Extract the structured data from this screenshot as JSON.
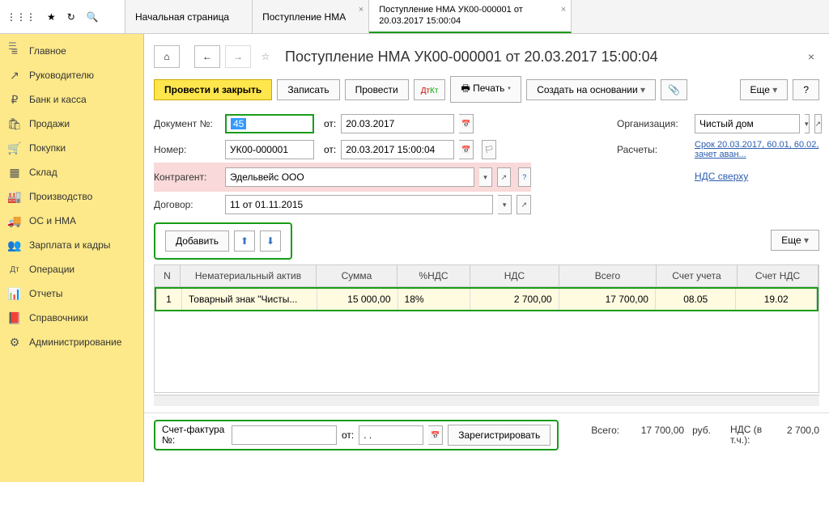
{
  "tabs": [
    {
      "label": "Начальная страница"
    },
    {
      "label": "Поступление НМА"
    },
    {
      "label": "Поступление НМА УК00-000001 от 20.03.2017 15:00:04",
      "active": true
    }
  ],
  "sidebar": {
    "items": [
      {
        "label": "Главное",
        "icon": "≡"
      },
      {
        "label": "Руководителю",
        "icon": "↗"
      },
      {
        "label": "Банк и касса",
        "icon": "₽"
      },
      {
        "label": "Продажи",
        "icon": "🛍"
      },
      {
        "label": "Покупки",
        "icon": "🛒"
      },
      {
        "label": "Склад",
        "icon": "▦"
      },
      {
        "label": "Производство",
        "icon": "🏭"
      },
      {
        "label": "ОС и НМА",
        "icon": "🚚"
      },
      {
        "label": "Зарплата и кадры",
        "icon": "👥"
      },
      {
        "label": "Операции",
        "icon": "Дт"
      },
      {
        "label": "Отчеты",
        "icon": "📊"
      },
      {
        "label": "Справочники",
        "icon": "📕"
      },
      {
        "label": "Администрирование",
        "icon": "⚙"
      }
    ]
  },
  "doc": {
    "title": "Поступление НМА УК00-000001 от 20.03.2017 15:00:04",
    "actions": {
      "post_close": "Провести и закрыть",
      "write": "Записать",
      "post": "Провести",
      "print": "Печать",
      "create_based": "Создать на основании",
      "more": "Еще",
      "help": "?"
    },
    "labels": {
      "doc_no": "Документ №:",
      "from": "от:",
      "number": "Номер:",
      "counterparty": "Контрагент:",
      "contract": "Договор:",
      "organization": "Организация:",
      "settlements": "Расчеты:",
      "add": "Добавить",
      "more2": "Еще",
      "invoice_no": "Счет-фактура №:",
      "register": "Зарегистрировать",
      "total": "Всего:",
      "currency": "руб.",
      "vat_sum": "НДС (в т.ч.):"
    },
    "fields": {
      "doc_no": "45",
      "date": "20.03.2017",
      "number": "УК00-000001",
      "datetime": "20.03.2017 15:00:04",
      "counterparty": "Эдельвейс ООО",
      "contract": "11 от 01.11.2015",
      "organization": "Чистый дом",
      "settlements": "Срок 20.03.2017, 60.01, 60.02, зачет аван...",
      "vat_mode": "НДС сверху"
    },
    "table": {
      "headers": {
        "n": "N",
        "asset": "Нематериальный актив",
        "sum": "Сумма",
        "vatpct": "%НДС",
        "vat": "НДС",
        "total": "Всего",
        "account": "Счет учета",
        "vat_account": "Счет НДС"
      },
      "row": {
        "n": "1",
        "asset": "Товарный знак \"Чисты...",
        "sum": "15 000,00",
        "vatpct": "18%",
        "vat": "2 700,00",
        "total": "17 700,00",
        "account": "08.05",
        "vat_account": "19.02"
      }
    },
    "footer": {
      "invoice_date": ". .",
      "total": "17 700,00",
      "vat": "2 700,0"
    }
  }
}
